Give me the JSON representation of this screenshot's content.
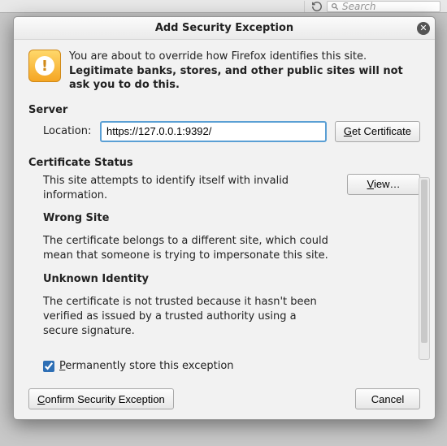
{
  "background": {
    "search_placeholder": "Search"
  },
  "dialog": {
    "title": "Add Security Exception",
    "intro_line1": "You are about to override how Firefox identifies this site.",
    "intro_line2": "Legitimate banks, stores, and other public sites will not ask you to do this.",
    "server_heading": "Server",
    "location_label": "Location:",
    "location_value": "https://127.0.0.1:9392/",
    "get_cert_prefix": "G",
    "get_cert_rest": "et Certificate",
    "status_heading": "Certificate Status",
    "status_intro": "This site attempts to identify itself with invalid information.",
    "view_prefix": "V",
    "view_rest": "iew…",
    "wrong_site_head": "Wrong Site",
    "wrong_site_body": "The certificate belongs to a different site, which could mean that someone is trying to impersonate this site.",
    "unknown_head": "Unknown Identity",
    "unknown_body": "The certificate is not trusted because it hasn't been verified as issued by a trusted authority using a secure signature.",
    "perm_prefix": "P",
    "perm_rest": "ermanently store this exception",
    "confirm_prefix": "C",
    "confirm_rest": "onfirm Security Exception",
    "cancel": "Cancel"
  }
}
